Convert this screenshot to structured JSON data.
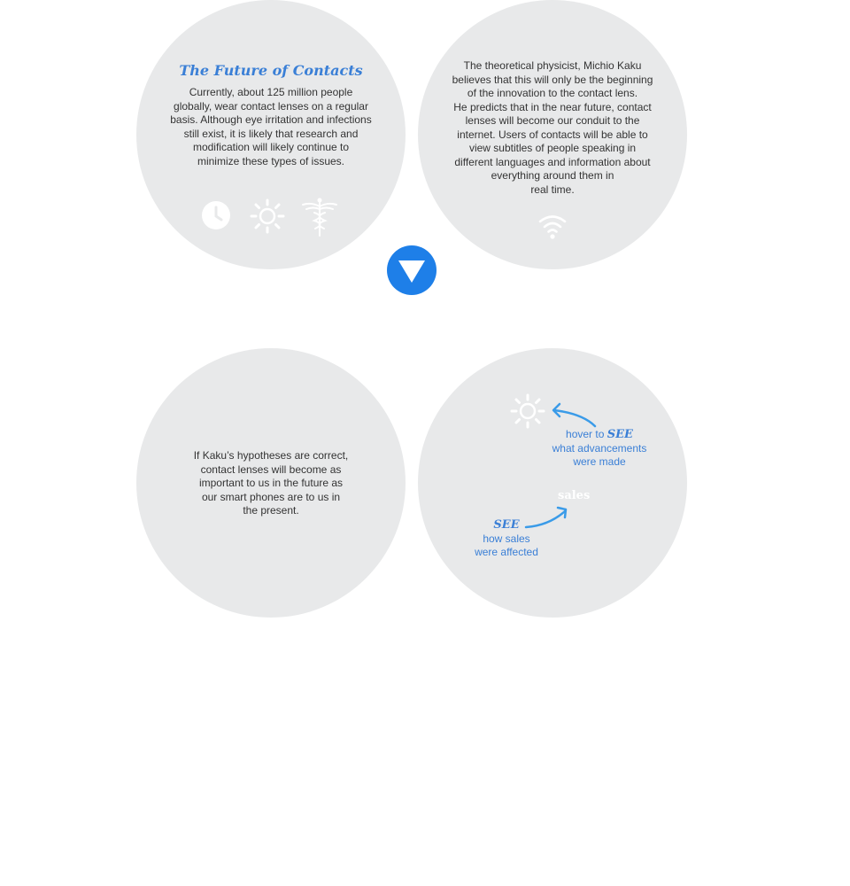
{
  "future": {
    "title": "The Future of Contacts",
    "lines": [
      "Currently, about 125 million people",
      "globally, wear contact lenses on a regular",
      "basis. Although eye irritation and infections",
      "still exist, it is likely that research and",
      "modification will likely continue to",
      "minimize these types of issues."
    ],
    "icons": [
      "clock-icon",
      "sun-icon",
      "caduceus-icon"
    ]
  },
  "kaku": {
    "lines": [
      "The theoretical physicist, Michio Kaku",
      "believes that this will only be the beginning",
      "of the innovation to the contact lens.",
      "He predicts that in the near future, contact",
      "lenses will become our conduit to the",
      "internet. Users of contacts will be able to",
      "view subtitles of people speaking in",
      "different languages and information about",
      "everything around them in",
      "real time."
    ],
    "icon": "wifi-icon"
  },
  "hypothesis": {
    "lines": [
      "If Kaku’s hypotheses are correct,",
      "contact lenses will become as",
      "important to us in the future as",
      "our smart phones are to us in",
      "the present."
    ]
  },
  "hints": {
    "advancements": {
      "prefix": "hover to",
      "see": "SEE",
      "line2": "what advancements",
      "line3": "were made",
      "icon": "sun-icon"
    },
    "sales": {
      "label": "sales",
      "see": "SEE",
      "line2": "how sales",
      "line3": "were affected"
    }
  },
  "navigation": {
    "next_icon": "triangle-down-icon"
  },
  "colors": {
    "accent": "#3a7fd6",
    "button": "#1e7fe8",
    "circle": "#e8e9ea",
    "text": "#333333"
  }
}
